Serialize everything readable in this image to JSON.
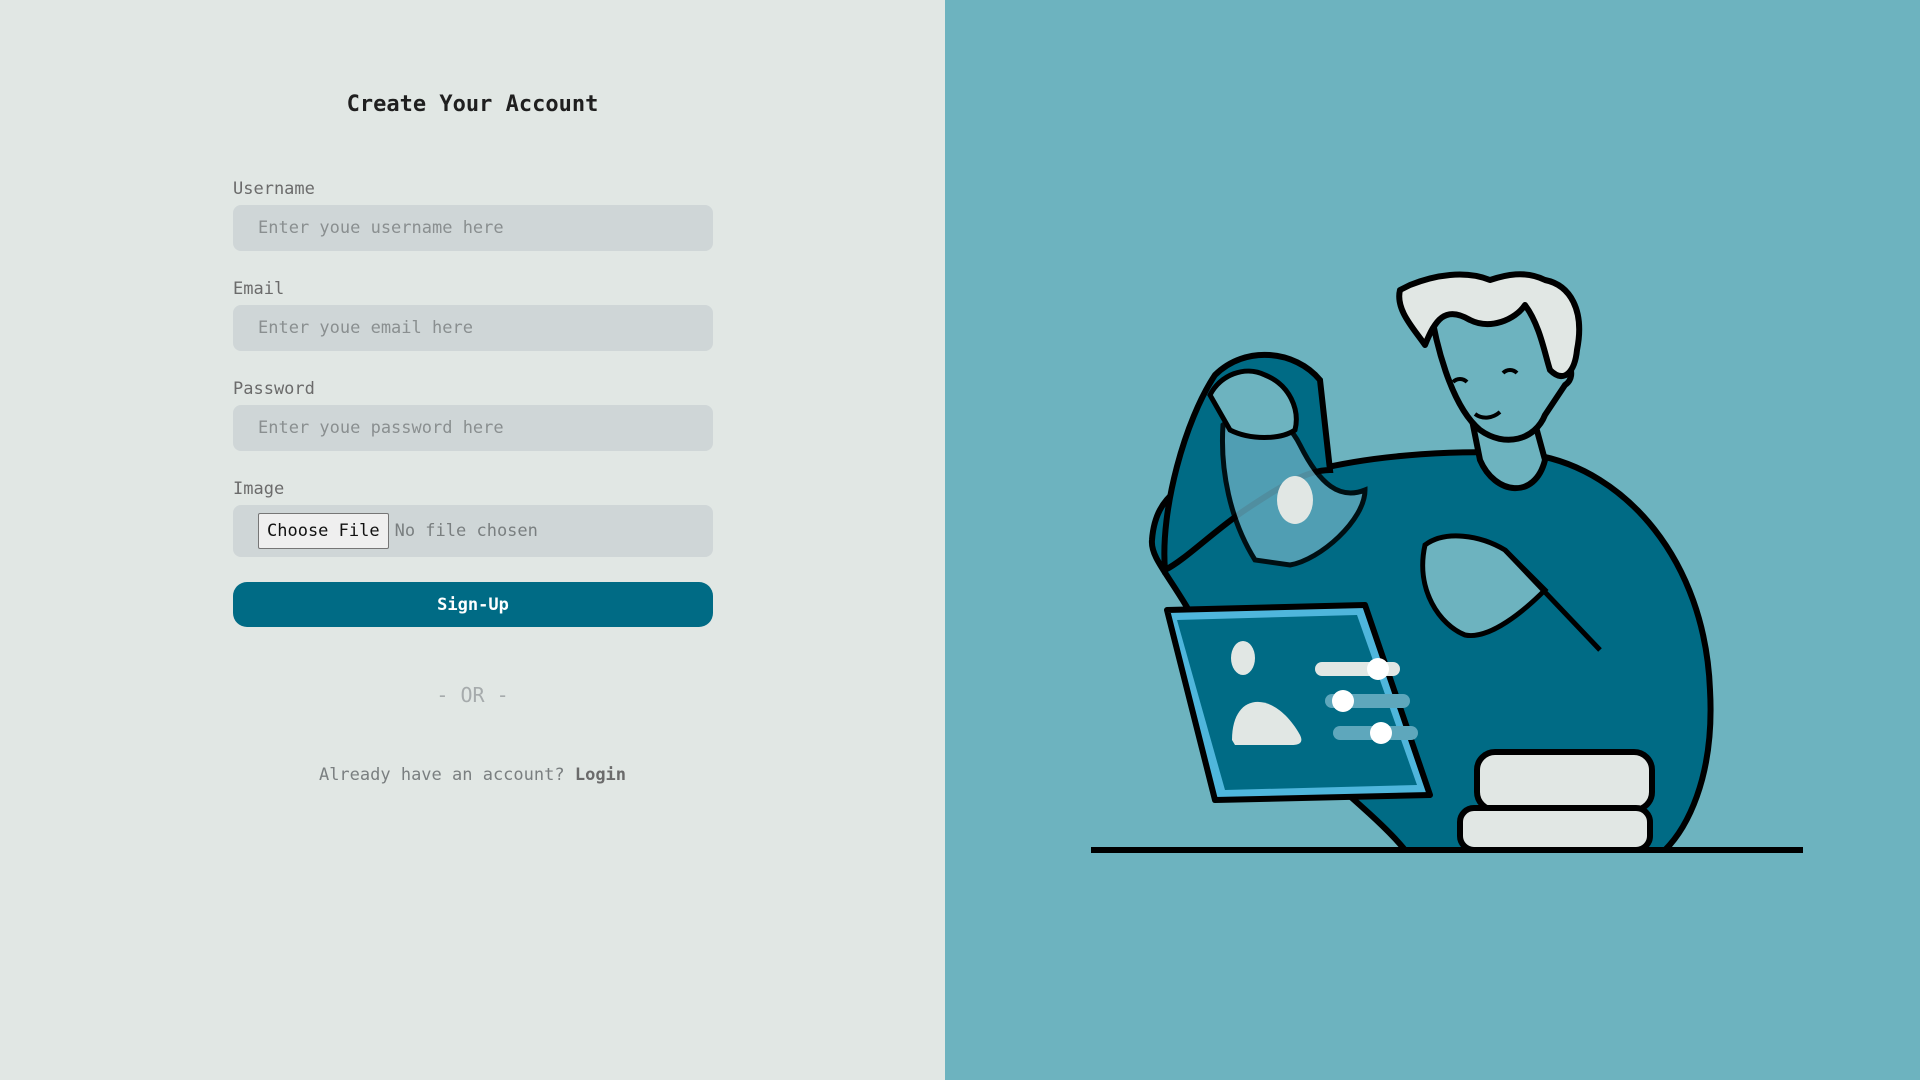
{
  "form": {
    "title": "Create Your Account",
    "username": {
      "label": "Username",
      "placeholder": "Enter youe username here"
    },
    "email": {
      "label": "Email",
      "placeholder": "Enter youe email here"
    },
    "password": {
      "label": "Password",
      "placeholder": "Enter youe password here"
    },
    "image": {
      "label": "Image",
      "button_label": "Choose File",
      "status": "No file chosen"
    },
    "submit_label": "Sign-Up"
  },
  "divider": {
    "text": "- OR -"
  },
  "login_prompt": {
    "text": "Already have an account?",
    "link_label": "Login"
  },
  "colors": {
    "left_background": "#e1e7e4",
    "right_background": "#6db3bf",
    "primary": "#006b85",
    "input_background": "#cfd6d7"
  },
  "illustration": {
    "name": "person-with-tablet-illustration"
  }
}
